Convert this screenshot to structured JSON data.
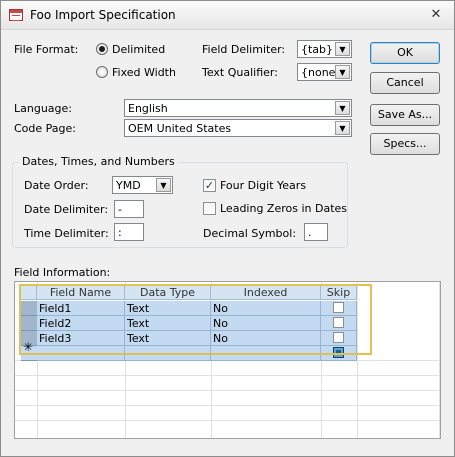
{
  "window": {
    "title": "Foo Import Specification",
    "close_glyph": "✕"
  },
  "file_format": {
    "label": "File Format:",
    "options": [
      {
        "label": "Delimited",
        "selected": true
      },
      {
        "label": "Fixed Width",
        "selected": false
      }
    ]
  },
  "field_delimiter": {
    "label": "Field Delimiter:",
    "value": "{tab}"
  },
  "text_qualifier": {
    "label": "Text Qualifier:",
    "value": "{none}"
  },
  "buttons": {
    "ok": "OK",
    "cancel": "Cancel",
    "save_as": "Save As...",
    "specs": "Specs..."
  },
  "language": {
    "label": "Language:",
    "value": "English"
  },
  "code_page": {
    "label": "Code Page:",
    "value": "OEM United States"
  },
  "dates_group": {
    "title": "Dates, Times, and Numbers",
    "date_order": {
      "label": "Date Order:",
      "value": "YMD"
    },
    "date_delimiter": {
      "label": "Date Delimiter:",
      "value": "-"
    },
    "time_delimiter": {
      "label": "Time Delimiter:",
      "value": ":"
    },
    "four_digit_years": {
      "label": "Four Digit Years",
      "checked": true
    },
    "leading_zeros": {
      "label": "Leading Zeros in Dates",
      "checked": false
    },
    "decimal_symbol": {
      "label": "Decimal Symbol:",
      "value": "."
    }
  },
  "field_info": {
    "label": "Field Information:",
    "columns": [
      "Field Name",
      "Data Type",
      "Indexed",
      "Skip"
    ],
    "rows": [
      {
        "field_name": "Field1",
        "data_type": "Text",
        "indexed": "No",
        "skip": false
      },
      {
        "field_name": "Field2",
        "data_type": "Text",
        "indexed": "No",
        "skip": false
      },
      {
        "field_name": "Field3",
        "data_type": "Text",
        "indexed": "No",
        "skip": false
      }
    ],
    "new_row_marker": "✳"
  },
  "icons": {
    "dropdown_arrow": "▼",
    "check_mark": "✓"
  }
}
